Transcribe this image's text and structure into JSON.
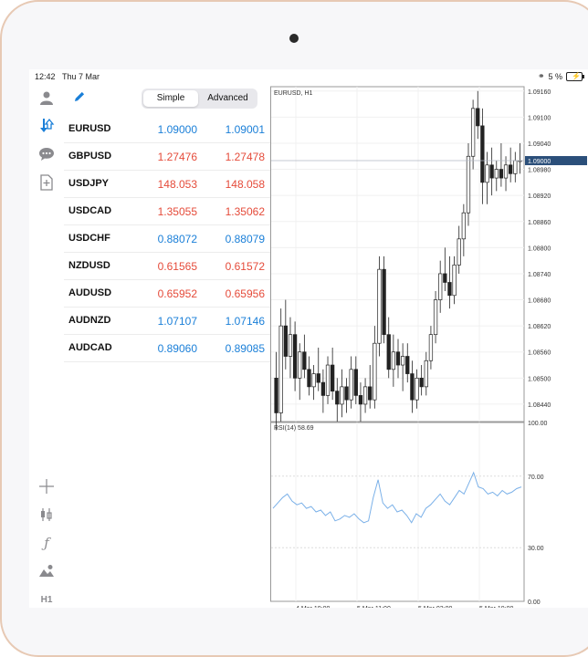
{
  "status": {
    "time": "12:42",
    "date": "Thu 7 Mar",
    "battery": "5 %"
  },
  "toolbar": {
    "simple_label": "Simple",
    "advanced_label": "Advanced"
  },
  "quotes": [
    {
      "symbol": "EURUSD",
      "bid": "1.09000",
      "ask": "1.09001",
      "dir": "up"
    },
    {
      "symbol": "GBPUSD",
      "bid": "1.27476",
      "ask": "1.27478",
      "dir": "down"
    },
    {
      "symbol": "USDJPY",
      "bid": "148.053",
      "ask": "148.058",
      "dir": "down"
    },
    {
      "symbol": "USDCAD",
      "bid": "1.35055",
      "ask": "1.35062",
      "dir": "down"
    },
    {
      "symbol": "USDCHF",
      "bid": "0.88072",
      "ask": "0.88079",
      "dir": "up"
    },
    {
      "symbol": "NZDUSD",
      "bid": "0.61565",
      "ask": "0.61572",
      "dir": "down"
    },
    {
      "symbol": "AUDUSD",
      "bid": "0.65952",
      "ask": "0.65956",
      "dir": "down"
    },
    {
      "symbol": "AUDNZD",
      "bid": "1.07107",
      "ask": "1.07146",
      "dir": "up"
    },
    {
      "symbol": "AUDCAD",
      "bid": "0.89060",
      "ask": "0.89085",
      "dir": "up"
    }
  ],
  "sidebar": {
    "timeframe_label": "H1"
  },
  "chart_data": {
    "type": "candlestick",
    "title": "EURUSD, H1",
    "current_price": "1.09000",
    "price_ticks": [
      "1.09160",
      "1.09100",
      "1.09040",
      "1.08980",
      "1.08920",
      "1.08860",
      "1.08800",
      "1.08740",
      "1.08680",
      "1.08620",
      "1.08560",
      "1.08500",
      "1.08440"
    ],
    "ylim": [
      1.084,
      1.0917
    ],
    "x_labels": [
      "4 Mar 19:00",
      "5 Mar 11:00",
      "5 Mar 03:00",
      "5 Mar 19:00"
    ],
    "candles": [
      [
        1.085,
        1.0856,
        1.0838,
        1.0842
      ],
      [
        1.0842,
        1.0866,
        1.084,
        1.0862
      ],
      [
        1.0862,
        1.0868,
        1.0852,
        1.0855
      ],
      [
        1.0855,
        1.0864,
        1.085,
        1.086
      ],
      [
        1.086,
        1.0863,
        1.0847,
        1.085
      ],
      [
        1.085,
        1.0858,
        1.0845,
        1.0856
      ],
      [
        1.0856,
        1.086,
        1.085,
        1.0852
      ],
      [
        1.0852,
        1.0855,
        1.0846,
        1.0848
      ],
      [
        1.0848,
        1.0853,
        1.0845,
        1.0851
      ],
      [
        1.0851,
        1.0857,
        1.0847,
        1.0849
      ],
      [
        1.0849,
        1.0852,
        1.0842,
        1.0846
      ],
      [
        1.0846,
        1.0855,
        1.0844,
        1.0853
      ],
      [
        1.0853,
        1.0857,
        1.0845,
        1.0847
      ],
      [
        1.0847,
        1.085,
        1.084,
        1.0844
      ],
      [
        1.0844,
        1.0852,
        1.0841,
        1.0848
      ],
      [
        1.0848,
        1.085,
        1.0842,
        1.0845
      ],
      [
        1.0845,
        1.0855,
        1.0843,
        1.0852
      ],
      [
        1.0852,
        1.0855,
        1.0844,
        1.0846
      ],
      [
        1.0846,
        1.0849,
        1.084,
        1.0844
      ],
      [
        1.0844,
        1.085,
        1.0842,
        1.0848
      ],
      [
        1.0848,
        1.0853,
        1.0843,
        1.0845
      ],
      [
        1.0845,
        1.0862,
        1.0843,
        1.0858
      ],
      [
        1.0858,
        1.0878,
        1.0855,
        1.0875
      ],
      [
        1.0875,
        1.0878,
        1.0858,
        1.086
      ],
      [
        1.086,
        1.0864,
        1.085,
        1.0852
      ],
      [
        1.0852,
        1.086,
        1.0848,
        1.0856
      ],
      [
        1.0856,
        1.0859,
        1.085,
        1.0853
      ],
      [
        1.0853,
        1.0858,
        1.0847,
        1.0855
      ],
      [
        1.0855,
        1.0858,
        1.0849,
        1.0851
      ],
      [
        1.0851,
        1.0854,
        1.0842,
        1.0845
      ],
      [
        1.0845,
        1.0852,
        1.0843,
        1.085
      ],
      [
        1.085,
        1.0853,
        1.0846,
        1.0848
      ],
      [
        1.0848,
        1.0856,
        1.0846,
        1.0854
      ],
      [
        1.0854,
        1.0862,
        1.0852,
        1.086
      ],
      [
        1.086,
        1.087,
        1.0858,
        1.0868
      ],
      [
        1.0868,
        1.0877,
        1.0865,
        1.0874
      ],
      [
        1.0874,
        1.088,
        1.087,
        1.0872
      ],
      [
        1.0872,
        1.0878,
        1.0866,
        1.0869
      ],
      [
        1.0869,
        1.0878,
        1.0867,
        1.0876
      ],
      [
        1.0876,
        1.0885,
        1.0874,
        1.0882
      ],
      [
        1.0882,
        1.089,
        1.0878,
        1.0888
      ],
      [
        1.0888,
        1.0904,
        1.0885,
        1.0901
      ],
      [
        1.0901,
        1.0914,
        1.0898,
        1.0912
      ],
      [
        1.0912,
        1.0916,
        1.0905,
        1.0908
      ],
      [
        1.0908,
        1.0912,
        1.089,
        1.0895
      ],
      [
        1.0895,
        1.0902,
        1.089,
        1.0899
      ],
      [
        1.0899,
        1.0903,
        1.0892,
        1.0896
      ],
      [
        1.0896,
        1.09,
        1.0893,
        1.0898
      ],
      [
        1.0898,
        1.0904,
        1.0894,
        1.0896
      ],
      [
        1.0896,
        1.0901,
        1.0893,
        1.0899
      ],
      [
        1.0899,
        1.0903,
        1.0895,
        1.0897
      ],
      [
        1.0897,
        1.0902,
        1.0895,
        1.09
      ],
      [
        1.09,
        1.0904,
        1.0897,
        1.09
      ]
    ],
    "rsi": {
      "label": "RSI(14) 58.69",
      "ticks": [
        "100.00",
        "70.00",
        "30.00",
        "0.00"
      ],
      "ylim": [
        0,
        100
      ],
      "values": [
        52,
        55,
        58,
        60,
        56,
        54,
        55,
        52,
        53,
        50,
        51,
        48,
        50,
        45,
        46,
        48,
        47,
        49,
        46,
        44,
        45,
        58,
        68,
        55,
        52,
        54,
        50,
        51,
        48,
        44,
        49,
        47,
        52,
        54,
        57,
        60,
        56,
        54,
        58,
        62,
        60,
        66,
        72,
        64,
        63,
        60,
        61,
        59,
        62,
        60,
        61,
        63,
        64
      ]
    }
  }
}
